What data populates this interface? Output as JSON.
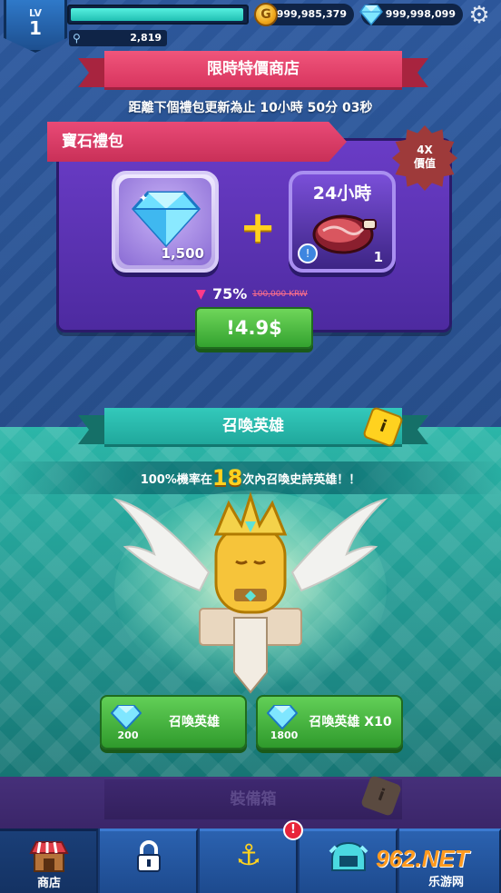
{
  "hud": {
    "level_label": "LV",
    "level_value": "1",
    "xp_fraction": 0.97,
    "power": "2,819",
    "gold": "999,985,379",
    "gems": "999,998,099",
    "icons": [
      "gold-coin-icon",
      "gem-icon",
      "settings-gear-icon",
      "power-icon"
    ]
  },
  "shop": {
    "title": "限時特價商店",
    "timer": "距離下個禮包更新為止 10小時 50分 03秒",
    "package": {
      "name": "寶石禮包",
      "badge_line1": "4X",
      "badge_line2": "價值",
      "gem_qty": "1,500",
      "plus": "+",
      "meat_title": "24小時",
      "meat_qty": "1",
      "discount": "75%",
      "old_price": "100,000 KRW",
      "price": "!4.9$"
    }
  },
  "summon": {
    "title": "召喚英雄",
    "rate_prefix": "100%機率在",
    "rate_number": "18",
    "rate_suffix": "次內召喚史詩英雄！！",
    "single": {
      "cost": "200",
      "label": "召喚英雄"
    },
    "multi": {
      "cost": "1800",
      "label": "召喚英雄 X10"
    }
  },
  "equipment": {
    "title": "裝備箱"
  },
  "nav": {
    "tabs": [
      {
        "name": "shop",
        "label": "商店",
        "icon": "shop-stall-icon",
        "active": true
      },
      {
        "name": "locked",
        "label": "",
        "icon": "lock-icon",
        "active": false
      },
      {
        "name": "anchor",
        "label": "",
        "icon": "anchor-icon",
        "active": false
      },
      {
        "name": "helmet",
        "label": "",
        "icon": "helmet-icon",
        "active": false
      },
      {
        "name": "more",
        "label": "",
        "icon": "unknown-icon",
        "active": false
      }
    ],
    "alert": "!"
  },
  "watermark": {
    "logo": "962.NET",
    "sub": "乐游网"
  },
  "colors": {
    "shop_ribbon": "#e23f6a",
    "summon_ribbon": "#27b5a8",
    "buy_button": "#4cbb42",
    "gold_text": "#ffd21f"
  }
}
